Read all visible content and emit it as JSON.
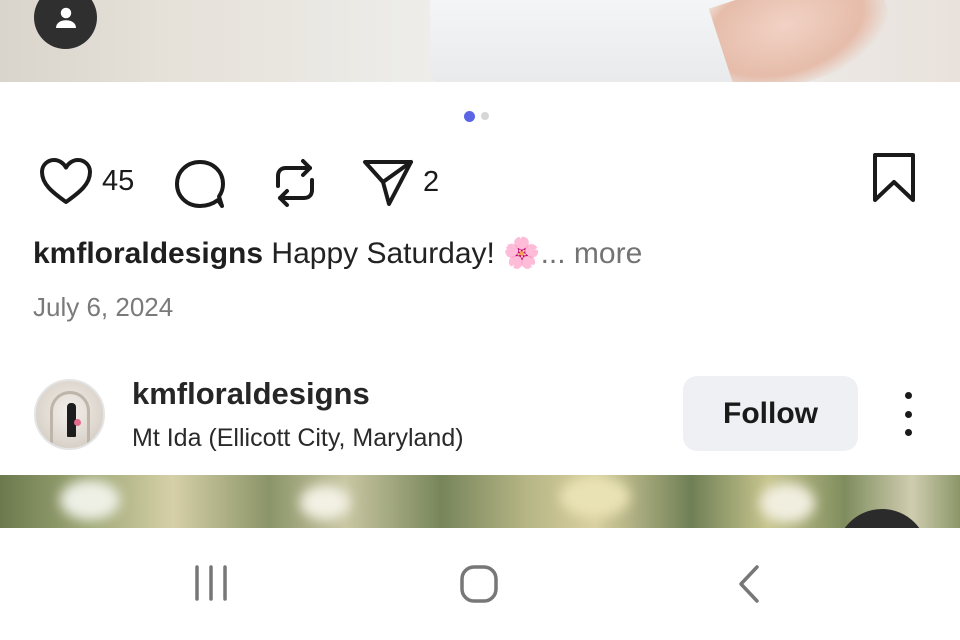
{
  "post": {
    "carousel": {
      "total": 2,
      "active": 1
    },
    "actions": {
      "likes_count": "45",
      "shares_count": "2"
    },
    "caption": {
      "username": "kmfloraldesigns",
      "text": "Happy Saturday! 🌸",
      "more_label": "... more"
    },
    "date": "July 6, 2024"
  },
  "next_post": {
    "username": "kmfloraldesigns",
    "location": "Mt Ida (Ellicott City, Maryland)",
    "follow_label": "Follow"
  },
  "icons": {
    "profile": "person-icon",
    "like": "heart-icon",
    "comment": "comment-icon",
    "repost": "repost-icon",
    "share": "send-icon",
    "save": "bookmark-icon",
    "options": "kebab-menu-icon",
    "nav_recent": "recent-apps-icon",
    "nav_home": "home-icon",
    "nav_back": "back-icon"
  },
  "colors": {
    "accent_dot": "#5b66e5",
    "follow_button_bg": "#eef0f4",
    "muted_text": "#737373"
  }
}
